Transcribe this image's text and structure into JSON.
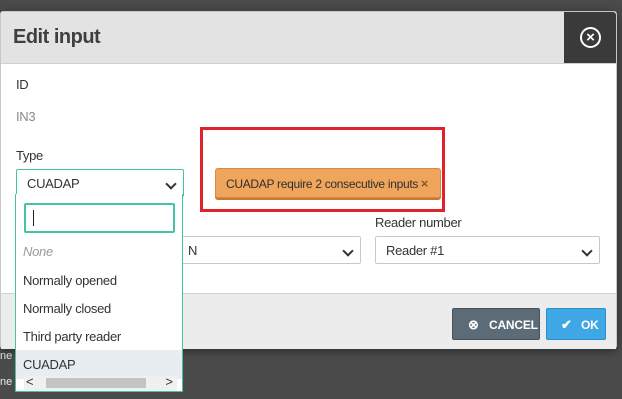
{
  "background": {
    "strip_text": "ne"
  },
  "modal": {
    "title": "Edit input",
    "close_icon": "close-circle-icon"
  },
  "form": {
    "id_label": "ID",
    "id_value": "IN3",
    "type_label": "Type",
    "type_value": "CUADAP",
    "second_select_value": "N",
    "reader_label": "Reader number",
    "reader_value": "Reader #1"
  },
  "tooltip": {
    "text": "CUADAP require 2 consecutive inputs",
    "close": "×",
    "color": "#f0a55c"
  },
  "dropdown": {
    "search_value": "",
    "options": [
      "None",
      "Normally opened",
      "Normally closed",
      "Third party reader",
      "CUADAP"
    ],
    "selected": "CUADAP",
    "scroll_left": "<",
    "scroll_right": ">"
  },
  "footer": {
    "cancel_label": "CANCEL",
    "ok_label": "OK",
    "cancel_icon": "x-circle-icon",
    "ok_icon": "check-icon"
  },
  "colors": {
    "accent": "#45c3a5",
    "ok": "#3fa7e6",
    "cancel": "#5c6b78",
    "highlight": "#e0232b"
  }
}
